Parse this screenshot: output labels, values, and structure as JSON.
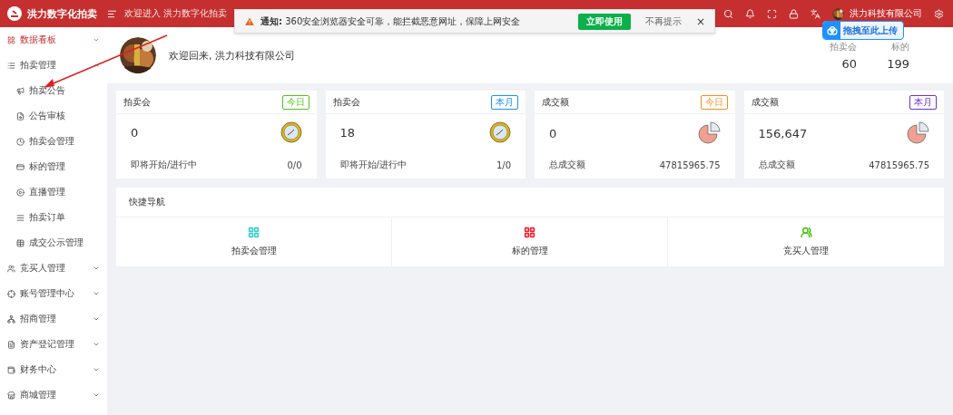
{
  "header": {
    "brand": "洪力数字化拍卖",
    "greeting": "欢迎进入 洪力数字化拍卖",
    "user_name": "洪力科技有限公司"
  },
  "notice": {
    "label": "通知:",
    "message": "360安全浏览器安全可靠，能拦截恶意网址，保障上网安全",
    "action": "立即使用",
    "dismiss": "不再提示",
    "close": "×"
  },
  "upload_badge": "拖拽至此上传",
  "sidebar": {
    "items": [
      {
        "label": "数据看板",
        "selected": true,
        "expanded": false
      },
      {
        "label": "拍卖管理",
        "selected": false,
        "expanded": true,
        "children": [
          {
            "label": "拍卖公告"
          },
          {
            "label": "公告审核"
          },
          {
            "label": "拍卖会管理"
          },
          {
            "label": "标的管理"
          },
          {
            "label": "直播管理"
          },
          {
            "label": "拍卖订单"
          },
          {
            "label": "成交公示管理"
          }
        ]
      },
      {
        "label": "竞买人管理",
        "selected": false,
        "expanded": false
      },
      {
        "label": "账号管理中心",
        "selected": false,
        "expanded": false
      },
      {
        "label": "招商管理",
        "selected": false,
        "expanded": false
      },
      {
        "label": "资产登记管理",
        "selected": false,
        "expanded": false
      },
      {
        "label": "财务中心",
        "selected": false,
        "expanded": false
      },
      {
        "label": "商城管理",
        "selected": false,
        "expanded": false
      }
    ]
  },
  "welcome": {
    "greeting": "欢迎回来, 洪力科技有限公司",
    "stats": [
      {
        "label": "拍卖会",
        "value": "60"
      },
      {
        "label": "标的",
        "value": "199"
      }
    ]
  },
  "cards": [
    {
      "kind": "clock",
      "title": "拍卖会",
      "tag": {
        "label": "今日",
        "color": "#52c41a"
      },
      "value": "0",
      "footer_label": "即将开始/进行中",
      "footer_value": "0/0"
    },
    {
      "kind": "clock",
      "title": "拍卖会",
      "tag": {
        "label": "本月",
        "color": "#1890ff"
      },
      "value": "18",
      "footer_label": "即将开始/进行中",
      "footer_value": "1/0"
    },
    {
      "kind": "pie",
      "title": "成交额",
      "tag": {
        "label": "今日",
        "color": "#fa8c16"
      },
      "value": "0",
      "footer_label": "总成交额",
      "footer_value": "47815965.75"
    },
    {
      "kind": "pie",
      "title": "成交额",
      "tag": {
        "label": "本月",
        "color": "#722ed1"
      },
      "value": "156,647",
      "footer_label": "总成交额",
      "footer_value": "47815965.75"
    }
  ],
  "quick_nav": {
    "title": "快捷导航",
    "items": [
      {
        "kind": "grid",
        "label": "拍卖会管理",
        "color": "#36cfc9"
      },
      {
        "kind": "grid",
        "label": "标的管理",
        "color": "#f5222d"
      },
      {
        "kind": "people",
        "label": "竞买人管理",
        "color": "#52c41a"
      }
    ]
  }
}
